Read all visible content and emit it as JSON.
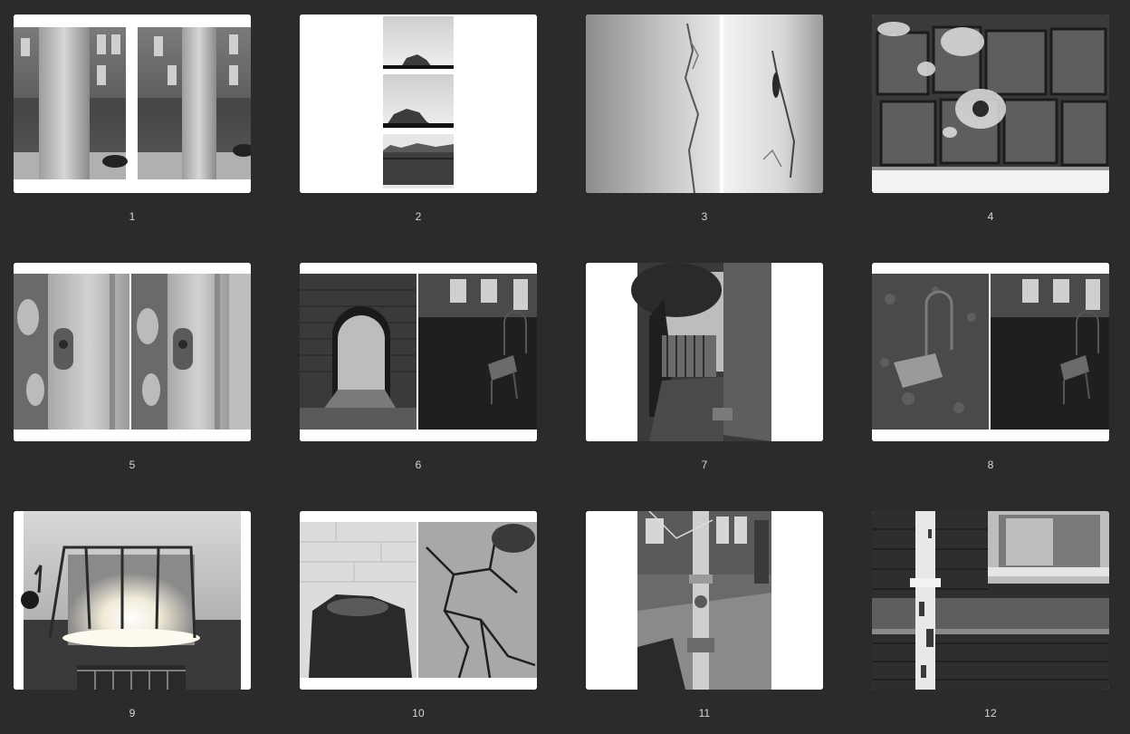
{
  "pages": [
    {
      "number": "1",
      "thumbnail": "spread-pole-facade-pair"
    },
    {
      "number": "2",
      "thumbnail": "triptych-rock-horizon"
    },
    {
      "number": "3",
      "thumbnail": "spread-peeling-paint"
    },
    {
      "number": "4",
      "thumbnail": "brick-wall-lichen"
    },
    {
      "number": "5",
      "thumbnail": "spread-door-lock-pair"
    },
    {
      "number": "6",
      "thumbnail": "spread-archway-and-chair"
    },
    {
      "number": "7",
      "thumbnail": "courtyard-tree-alley"
    },
    {
      "number": "8",
      "thumbnail": "spread-chair-on-grass"
    },
    {
      "number": "9",
      "thumbnail": "glowing-swing-frame"
    },
    {
      "number": "10",
      "thumbnail": "spread-soil-and-cracked-ground"
    },
    {
      "number": "11",
      "thumbnail": "street-post-building"
    },
    {
      "number": "12",
      "thumbnail": "rusty-drainpipe-wall"
    }
  ]
}
